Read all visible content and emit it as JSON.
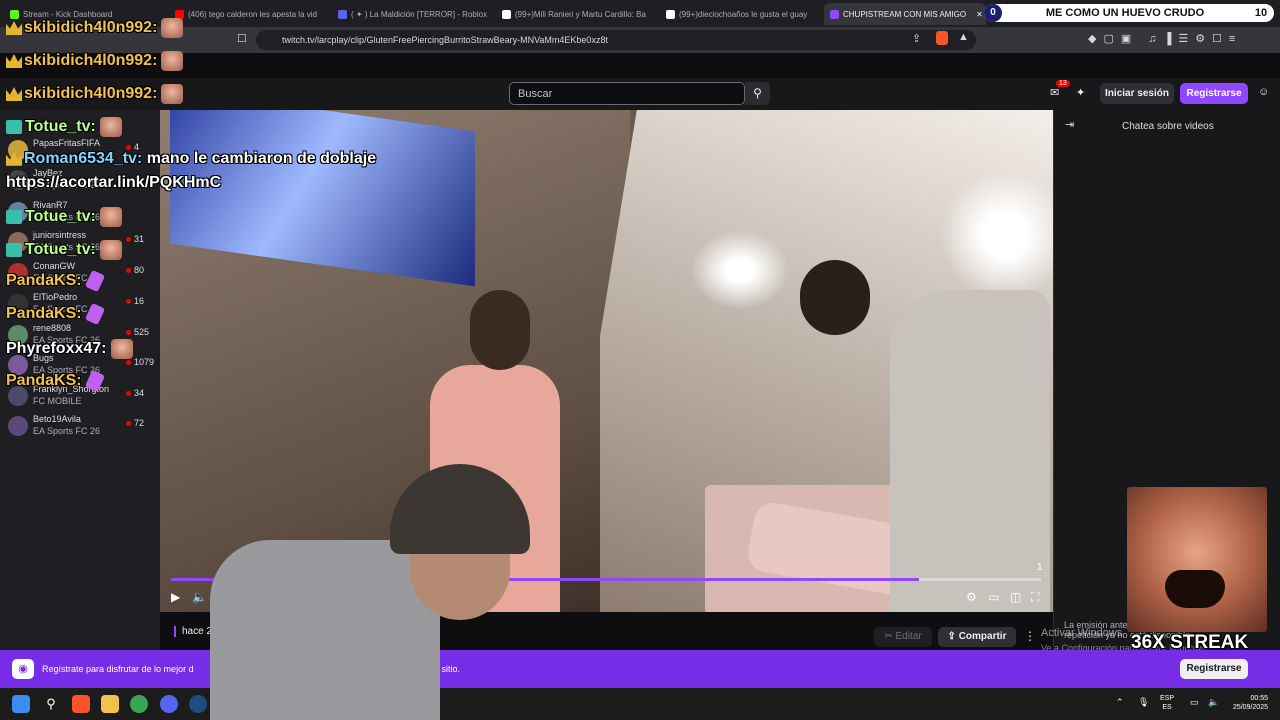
{
  "browser": {
    "tabs": [
      {
        "title": "Stream - Kick Dashboard",
        "color": "#53fc18"
      },
      {
        "title": "(406) tego calderon les apesta la vid",
        "color": "#ff0000"
      },
      {
        "title": "( ✦ ) La Maldición [TERROR] - Roblox",
        "color": "#5865f2"
      },
      {
        "title": "(99+)Mili Ranieri y Martu Cardillo: Ba",
        "color": "#ffffff"
      },
      {
        "title": "(99+)dieciochoaños le gusta el guay",
        "color": "#ffffff"
      },
      {
        "title": "CHUPISTREAM CON MIS AMIGO",
        "color": "#9147ff"
      }
    ],
    "url": "twitch.tv/larcplay/clip/GlutenFreePiercingBurritoStrawBeary-MNVaMm4EKbe0xz8t"
  },
  "counter": {
    "left": "0",
    "text": "ME COMO UN HUEVO CRUDO",
    "right": "10"
  },
  "twitch": {
    "search_placeholder": "Buscar",
    "notification_count": "13",
    "login_label": "Iniciar sesión",
    "register_label": "Registrarse",
    "chat_title": "Chatea sobre videos"
  },
  "sidebar": {
    "channels": [
      {
        "name": "PapasFritasFIFA",
        "game": "",
        "viewers": "4"
      },
      {
        "name": "JayBez",
        "game": "EA Sports FC 26",
        "viewers": ""
      },
      {
        "name": "RivanR7",
        "game": "EA Sports FC 26",
        "viewers": ""
      },
      {
        "name": "juniorsintress",
        "game": "EA Sports FC 26",
        "viewers": "31"
      },
      {
        "name": "ConanGW",
        "game": "EA Sports FC 26",
        "viewers": "80"
      },
      {
        "name": "ElTioPedro",
        "game": "EA Sports FC 26",
        "viewers": "16"
      },
      {
        "name": "rene8808",
        "game": "EA Sports FC 26",
        "viewers": "525"
      },
      {
        "name": "Bugs",
        "game": "EA Sports FC 26",
        "viewers": "1079"
      },
      {
        "name": "Franklyn_Shorgton",
        "game": "FC MOBILE",
        "viewers": "34"
      },
      {
        "name": "Beto19Avila",
        "game": "EA Sports FC 26",
        "viewers": "72"
      }
    ]
  },
  "player": {
    "clip_number": "1",
    "progress": 0.86
  },
  "clip_info": {
    "age": "hace 2 añ",
    "edit_label": "Editar",
    "share_label": "Compartir",
    "expired_note": "La emisión anterior de este clip ha caducado y la repetición ya no está disponible."
  },
  "windows_watermark": {
    "line1": "Activar Windows",
    "line2": "Ve a Configuración para activar Windows."
  },
  "banner": {
    "text": "Regístrate para disfrutar de lo mejor d",
    "text_end": "n es tu sitio.",
    "button": "Registrarse"
  },
  "overlay_chat": [
    {
      "user": "skibidich4l0n992:",
      "msg": "",
      "style": "u",
      "emote": "face",
      "badge": "crown"
    },
    {
      "user": "skibidich4l0n992:",
      "msg": "",
      "style": "u",
      "emote": "face",
      "badge": "crown"
    },
    {
      "user": "skibidich4l0n992:",
      "msg": "",
      "style": "u",
      "emote": "face",
      "badge": "crown"
    },
    {
      "user": "Totue_tv:",
      "msg": "",
      "style": "g",
      "emote": "face",
      "badge": "g"
    },
    {
      "user": "Roman6534_tv:",
      "msg": "mano le cambiaron de doblaje",
      "style": "c",
      "emote": "",
      "badge": "crown"
    },
    {
      "user": "",
      "msg": "https://acortar.link/PQKHmC",
      "style": "",
      "emote": "",
      "badge": ""
    },
    {
      "user": "Totue_tv:",
      "msg": "",
      "style": "g",
      "emote": "face",
      "badge": "g"
    },
    {
      "user": "Totue_tv:",
      "msg": "",
      "style": "g",
      "emote": "face",
      "badge": "g"
    },
    {
      "user": "PandaKS:",
      "msg": "",
      "style": "u",
      "emote": "pink",
      "badge": ""
    },
    {
      "user": "PandaKS:",
      "msg": "",
      "style": "u",
      "emote": "pink",
      "badge": ""
    },
    {
      "user": "Phyrefoxx47:",
      "msg": "",
      "style": "",
      "emote": "face",
      "badge": ""
    },
    {
      "user": "PandaKS:",
      "msg": "",
      "style": "u",
      "emote": "pink",
      "badge": ""
    }
  ],
  "streak": {
    "text": "36X STREAK"
  },
  "taskbar": {
    "lang1": "ESP",
    "lang2": "ES",
    "time": "00:55",
    "date": "25/09/2025"
  }
}
